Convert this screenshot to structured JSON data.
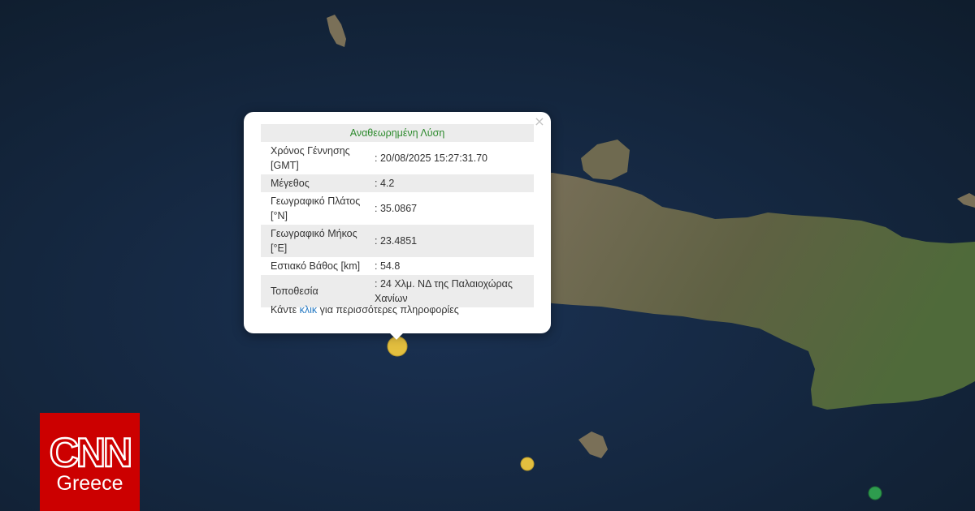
{
  "popup": {
    "title": "Αναθεωρημένη Λύση",
    "close_symbol": "×",
    "rows": [
      {
        "label": "Χρόνος Γέννησης [GMT]",
        "value": ": 20/08/2025 15:27:31.70"
      },
      {
        "label": "Μέγεθος",
        "value": ": 4.2"
      },
      {
        "label": "Γεωγραφικό Πλάτος [°N]",
        "value": ": 35.0867"
      },
      {
        "label": "Γεωγραφικό Μήκος [°E]",
        "value": ": 23.4851"
      },
      {
        "label": "Εστιακό Βάθος [km]",
        "value": ": 54.8"
      },
      {
        "label": "Τοποθεσία",
        "value": ": 24 Χλμ. ΝΔ της Παλαιοχώρας Χανίων"
      }
    ],
    "more_prefix": "Κάντε",
    "more_link": "κλικ",
    "more_suffix": "για περισσότερες πληροφορίες"
  },
  "markers": [
    {
      "name": "selected-earthquake-marker",
      "color": "#e3bf3f"
    },
    {
      "name": "earthquake-marker-south",
      "color": "#e3bf3f"
    },
    {
      "name": "earthquake-marker-green",
      "color": "#2e9c4e"
    }
  ],
  "colors": {
    "sea": "#122236",
    "land": "#6e6a4e",
    "header_text": "#2d8a2d",
    "link": "#2478c2",
    "brand": "#cc0000"
  },
  "logo": {
    "brand": "CNN",
    "region": "Greece"
  }
}
